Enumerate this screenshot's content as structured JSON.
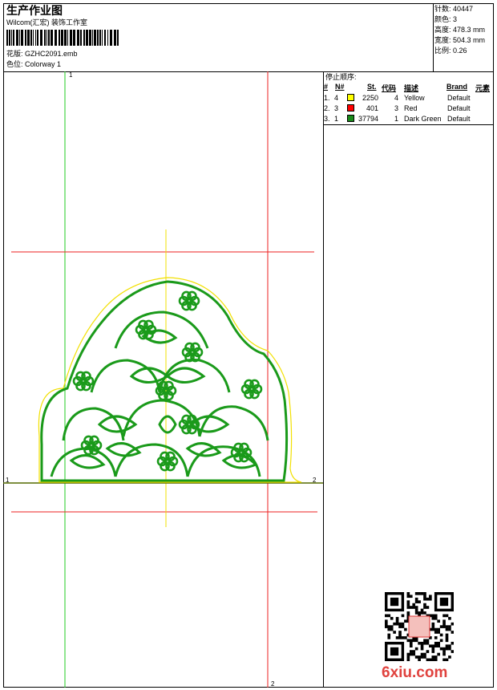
{
  "header": {
    "title": "生产作业图",
    "studio": "Wilcom(汇宏) 装饰工作室",
    "pattern_label": "花版:  GZHC2091.emb",
    "colorway_label": "色位:  Colorway 1"
  },
  "info": [
    {
      "label": "针数:",
      "value": "40447"
    },
    {
      "label": "颜色:",
      "value": "3"
    },
    {
      "label": "高度:",
      "value": "478.3 mm"
    },
    {
      "label": "宽度:",
      "value": "504.3 mm"
    },
    {
      "label": "比例:",
      "value": "0.26"
    }
  ],
  "stop_sequence": {
    "title": "停止顺序:",
    "columns": [
      "#",
      "N#",
      "St.",
      "代码",
      "描述",
      "Brand",
      "元素"
    ],
    "rows": [
      {
        "index": "1.",
        "n": "4",
        "color": "#ffff00",
        "stitches": "2250",
        "code": "4",
        "description": "Yellow",
        "brand": "Default"
      },
      {
        "index": "2.",
        "n": "3",
        "color": "#ff0000",
        "stitches": "401",
        "code": "3",
        "description": "Red",
        "brand": "Default"
      },
      {
        "index": "3.",
        "n": "1",
        "color": "#1a8a1a",
        "stitches": "37794",
        "code": "1",
        "description": "Dark Green",
        "brand": "Default"
      }
    ]
  },
  "canvas": {
    "marker_left_top": "1",
    "marker_left_baseline": "1",
    "marker_right_baseline": "2",
    "marker_right_bottom": "2",
    "colors": {
      "guide_green": "#22cc22",
      "guide_red": "#ee2222",
      "guide_yellow": "#f2e000",
      "design_green": "#1a9a1a"
    }
  },
  "watermark": "6xiu.com"
}
